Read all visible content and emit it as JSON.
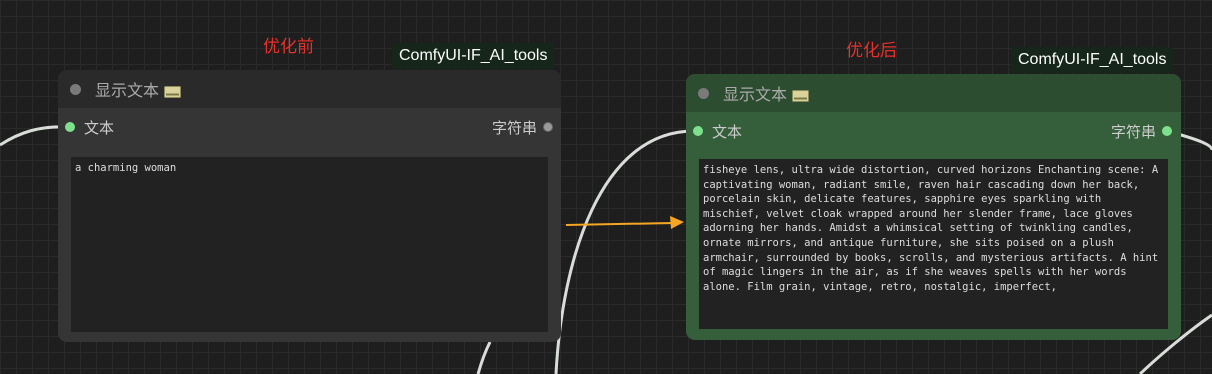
{
  "captions": {
    "before": "优化前",
    "after": "优化后"
  },
  "left_node": {
    "badge": "ComfyUI-IF_AI_tools",
    "title": "显示文本",
    "input_label": "文本",
    "output_label": "字符串",
    "text": "a charming woman"
  },
  "right_node": {
    "badge": "ComfyUI-IF_AI_tools",
    "title": "显示文本",
    "input_label": "文本",
    "output_label": "字符串",
    "text": "fisheye lens, ultra wide distortion, curved horizons Enchanting scene: A captivating woman, radiant smile, raven hair cascading down her back, porcelain skin, delicate features, sapphire eyes sparkling with mischief, velvet cloak wrapped around her slender frame, lace gloves adorning her hands. Amidst a whimsical setting of twinkling candles, ornate mirrors, and antique furniture, she sits poised on a plush armchair, surrounded by books, scrolls, and mysterious artifacts. A hint of magic lingers in the air, as if she weaves spells with her words alone. Film grain, vintage, retro, nostalgic, imperfect,"
  },
  "colors": {
    "canvas": "#1e1e1e",
    "node_default": "#353535",
    "node_green": "#355e3b",
    "caption": "#e8302a",
    "arrow": "#f5a623",
    "link": "#d8ddd8",
    "slot_active": "#7ee08d"
  },
  "icons": {
    "title_icon": "monitor-icon",
    "arrow": "right-arrow-icon"
  }
}
